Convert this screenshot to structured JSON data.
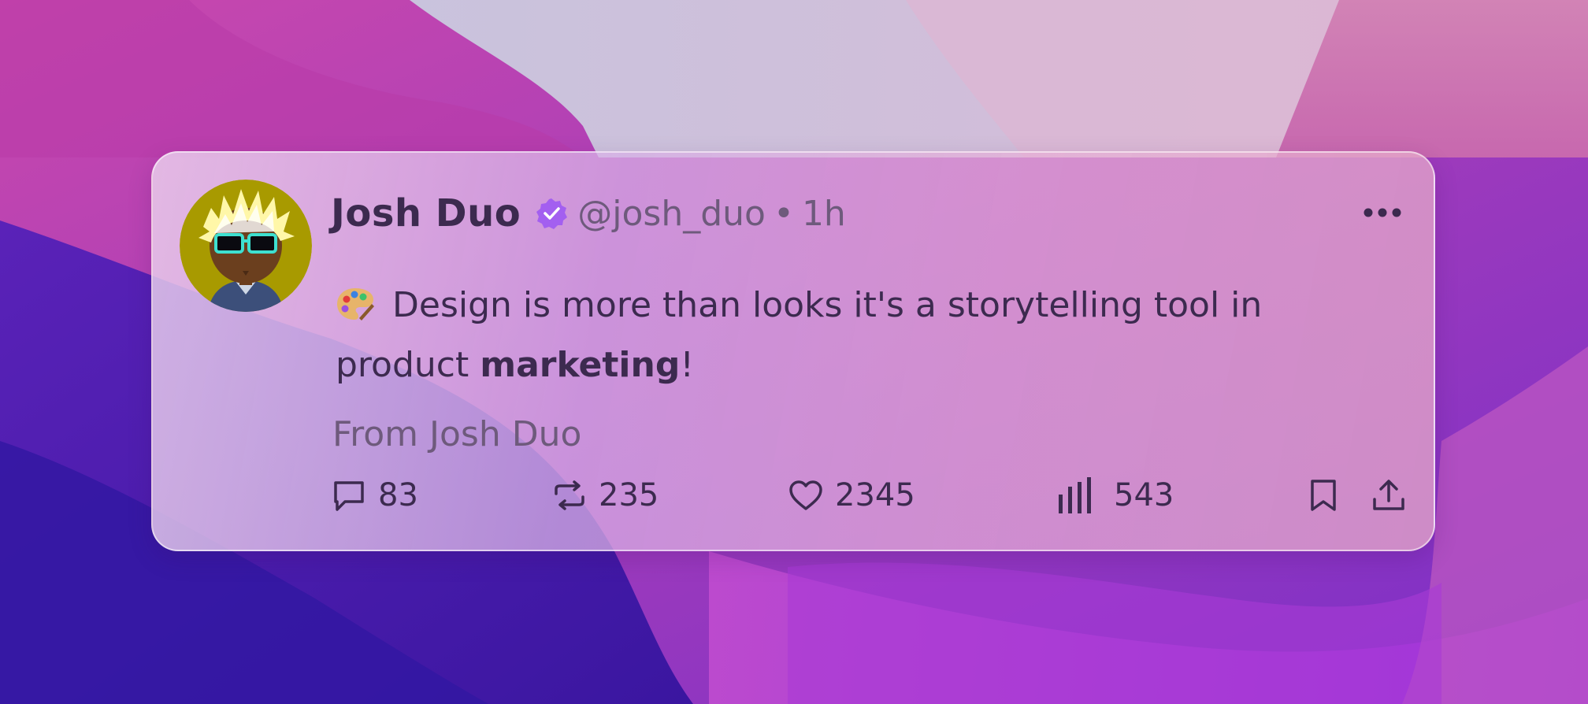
{
  "tweet": {
    "author_name": "Josh Duo",
    "handle": "@josh_duo",
    "separator": "•",
    "time": "1h",
    "body_emoji": "palette-emoji",
    "body_text_before": "Design is more than looks it's a storytelling tool in product ",
    "body_text_bold": "marketing",
    "body_text_after": "!",
    "from_label": "From Josh Duo"
  },
  "actions": {
    "replies": "83",
    "retweets": "235",
    "likes": "2345",
    "views": "543"
  },
  "icons": {
    "verified": "verified-badge-icon",
    "more": "more-options-icon",
    "reply": "reply-bubble-icon",
    "retweet": "retweet-icon",
    "like": "heart-icon",
    "views": "views-bar-chart-icon",
    "bookmark": "bookmark-icon",
    "share": "share-upload-icon"
  },
  "colors": {
    "text_primary": "#3c2a4f",
    "text_secondary": "#6e5a7c",
    "verified_badge": "#a35ff0",
    "avatar_bg": "#a89a00"
  }
}
